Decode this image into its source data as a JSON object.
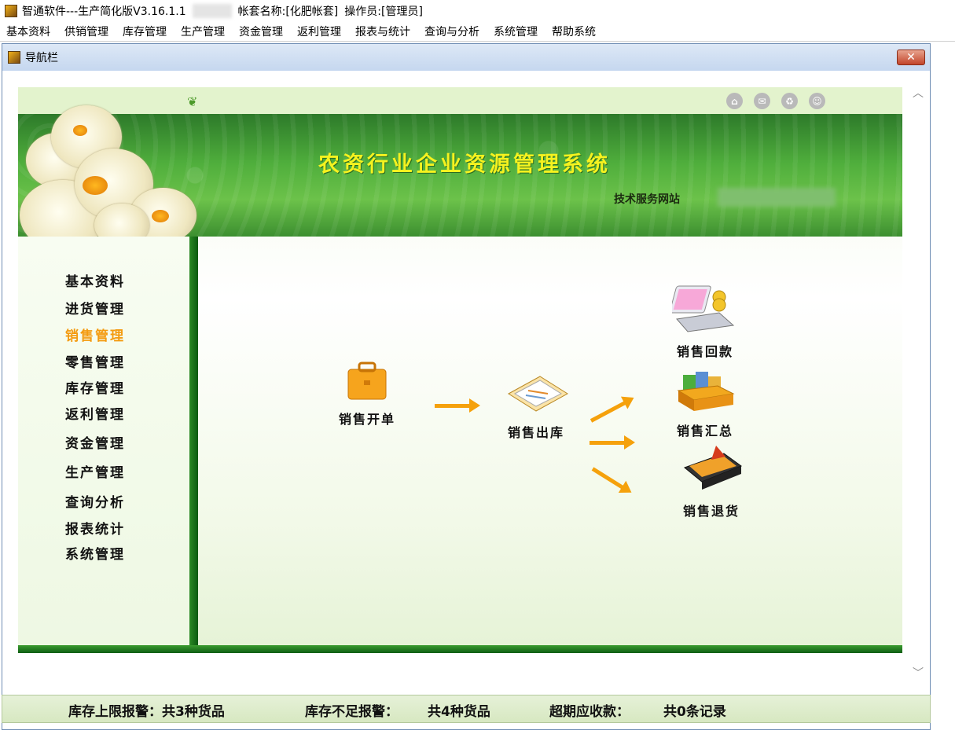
{
  "app": {
    "title_prefix": "智通软件---生产简化版V3.16.1.1",
    "account": "帐套名称:[化肥帐套]",
    "operator": "操作员:[管理员]"
  },
  "menu": [
    "基本资料",
    "供销管理",
    "库存管理",
    "生产管理",
    "资金管理",
    "返利管理",
    "报表与统计",
    "查询与分析",
    "系统管理",
    "帮助系统"
  ],
  "window": {
    "title": "导航栏",
    "close_label": "✕"
  },
  "banner": {
    "title": "农资行业企业资源管理系统",
    "site_label": "技术服务网站"
  },
  "top_icons": [
    "home-icon",
    "mail-icon",
    "recycle-icon",
    "smile-icon"
  ],
  "sidebar": {
    "items": [
      {
        "label": "基本资料",
        "active": false
      },
      {
        "label": "进货管理",
        "active": false
      },
      {
        "label": "销售管理",
        "active": true
      },
      {
        "label": "零售管理",
        "active": false
      },
      {
        "label": "库存管理",
        "active": false
      },
      {
        "label": "返利管理",
        "active": false
      },
      {
        "label": "资金管理",
        "active": false
      },
      {
        "label": "生产管理",
        "active": false
      },
      {
        "label": "查询分析",
        "active": false
      },
      {
        "label": "报表统计",
        "active": false
      },
      {
        "label": "系统管理",
        "active": false
      }
    ],
    "active_color": "#f49b10"
  },
  "flow": {
    "open_order": "销售开单",
    "outbound": "销售出库",
    "payment": "销售回款",
    "summary": "销售汇总",
    "return": "销售退货"
  },
  "status": {
    "upper_alarm": "库存上限报警：共3种货品",
    "shortage_label": "库存不足报警：",
    "shortage_value": "共4种货品",
    "overdue_label": "超期应收款：",
    "overdue_value": "共0条记录"
  },
  "colors": {
    "accent": "#f5a10c",
    "green_dark": "#0f5e14",
    "banner_text": "#f5f21f"
  }
}
